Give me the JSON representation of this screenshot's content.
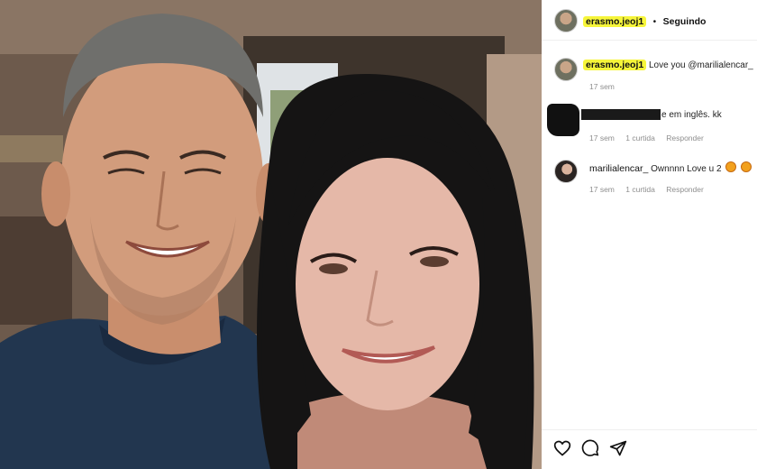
{
  "post": {
    "author": "erasmo.jeoj1",
    "separator": "•",
    "follow_status": "Seguindo"
  },
  "comments": [
    {
      "user": "erasmo.jeoj1",
      "text": "Love you @marilialencar_",
      "time": "17 sem"
    },
    {
      "user": "",
      "text": "e em inglês. kk",
      "time": "17 sem",
      "likes": "1 curtida",
      "reply": "Responder"
    },
    {
      "user": "marilialencar_",
      "text": "Ownnnn Love u 2",
      "time": "17 sem",
      "likes": "1 curtida",
      "reply": "Responder"
    }
  ],
  "actions": {
    "icons": [
      "heart-icon",
      "comment-icon",
      "share-icon"
    ]
  },
  "colors": {
    "highlight": "#f6f53a",
    "panel_bg": "#ffffff",
    "meta_text": "#8e8e8e"
  }
}
